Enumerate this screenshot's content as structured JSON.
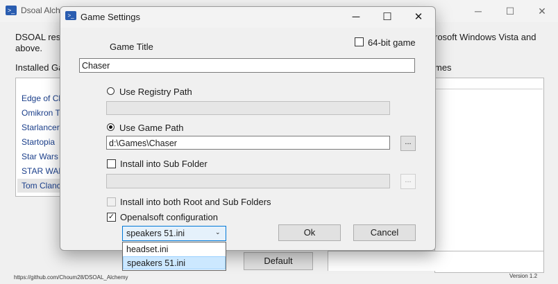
{
  "main": {
    "title": "Dsoal Alche",
    "description_left": "DSOAL resto",
    "description_left2": "above.",
    "description_right": "rosoft Windows Vista and",
    "installed_label": "Installed Gan",
    "games_label_right": "mes",
    "games": [
      "Edge of Ch",
      "Omikron T",
      "Starlancer",
      "Startopia",
      "Star Wars",
      "STAR WAR",
      "Tom Clanc"
    ],
    "default_button": "Default",
    "status_url": "https://github.com/Choum28/DSOAL_Alchemy",
    "version": "Version 1.2",
    "app_icon": "powershell-icon"
  },
  "dialog": {
    "title": "Game Settings",
    "minimize": "─",
    "maximize": "☐",
    "close": "✕",
    "sixtyfour_bit_label": "64-bit game",
    "game_title_label": "Game Title",
    "game_title_value": "Chaser",
    "use_registry_label": "Use Registry Path",
    "registry_path_value": "",
    "use_game_path_label": "Use Game Path",
    "game_path_value": "d:\\Games\\Chaser",
    "browse_label": "...",
    "install_sub_label": "Install into Sub Folder",
    "sub_folder_value": "",
    "install_both_label": "Install into both Root and Sub Folders",
    "openalsoft_label": "Openalsoft configuration",
    "openalsoft_checked": true,
    "config_selected": "speakers 51.ini",
    "config_options": [
      "headset.ini",
      "speakers 51.ini"
    ],
    "ok_label": "Ok",
    "cancel_label": "Cancel"
  },
  "win_controls": {
    "minimize": "─",
    "maximize": "☐",
    "close": "✕"
  }
}
